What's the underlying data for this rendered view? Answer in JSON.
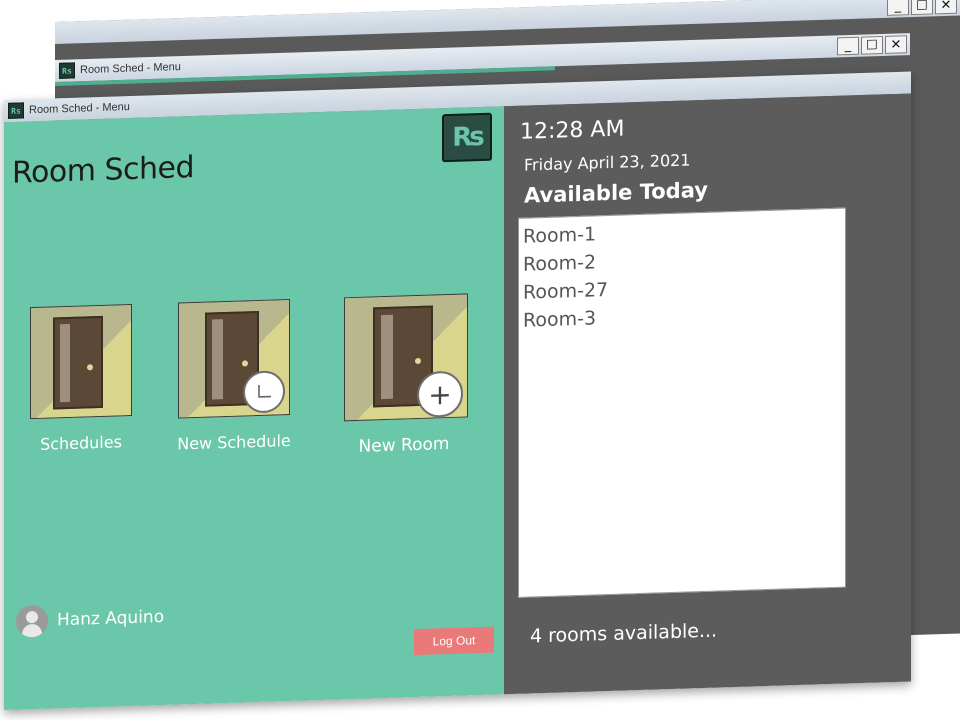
{
  "back_window": {
    "title": "Room Sched - Menu",
    "controls": {
      "minimize": "_",
      "maximize": "☐",
      "close": "✕"
    }
  },
  "window": {
    "title": "Room Sched - Menu",
    "icon": "Rs",
    "controls": {
      "minimize": "_",
      "maximize": "☐",
      "close": "✕"
    }
  },
  "left": {
    "app_title": "Room Sched",
    "logo": "Rs",
    "tiles": [
      {
        "label": "Schedules",
        "icon": "door-icon"
      },
      {
        "label": "New Schedule",
        "icon": "door-clock-icon"
      },
      {
        "label": "New Room",
        "icon": "door-plus-icon"
      }
    ],
    "user_name": "Hanz Aquino",
    "logout_label": "Log Out"
  },
  "right": {
    "time": "12:28 AM",
    "date": "Friday April 23, 2021",
    "available_title": "Available Today",
    "rooms": [
      "Room-1",
      "Room-2",
      "Room-27",
      "Room-3"
    ],
    "count_text": "4 rooms available..."
  },
  "colors": {
    "accent": "#6bc7aa",
    "panel": "#5c5c5c",
    "logout": "#ea7a7a"
  }
}
